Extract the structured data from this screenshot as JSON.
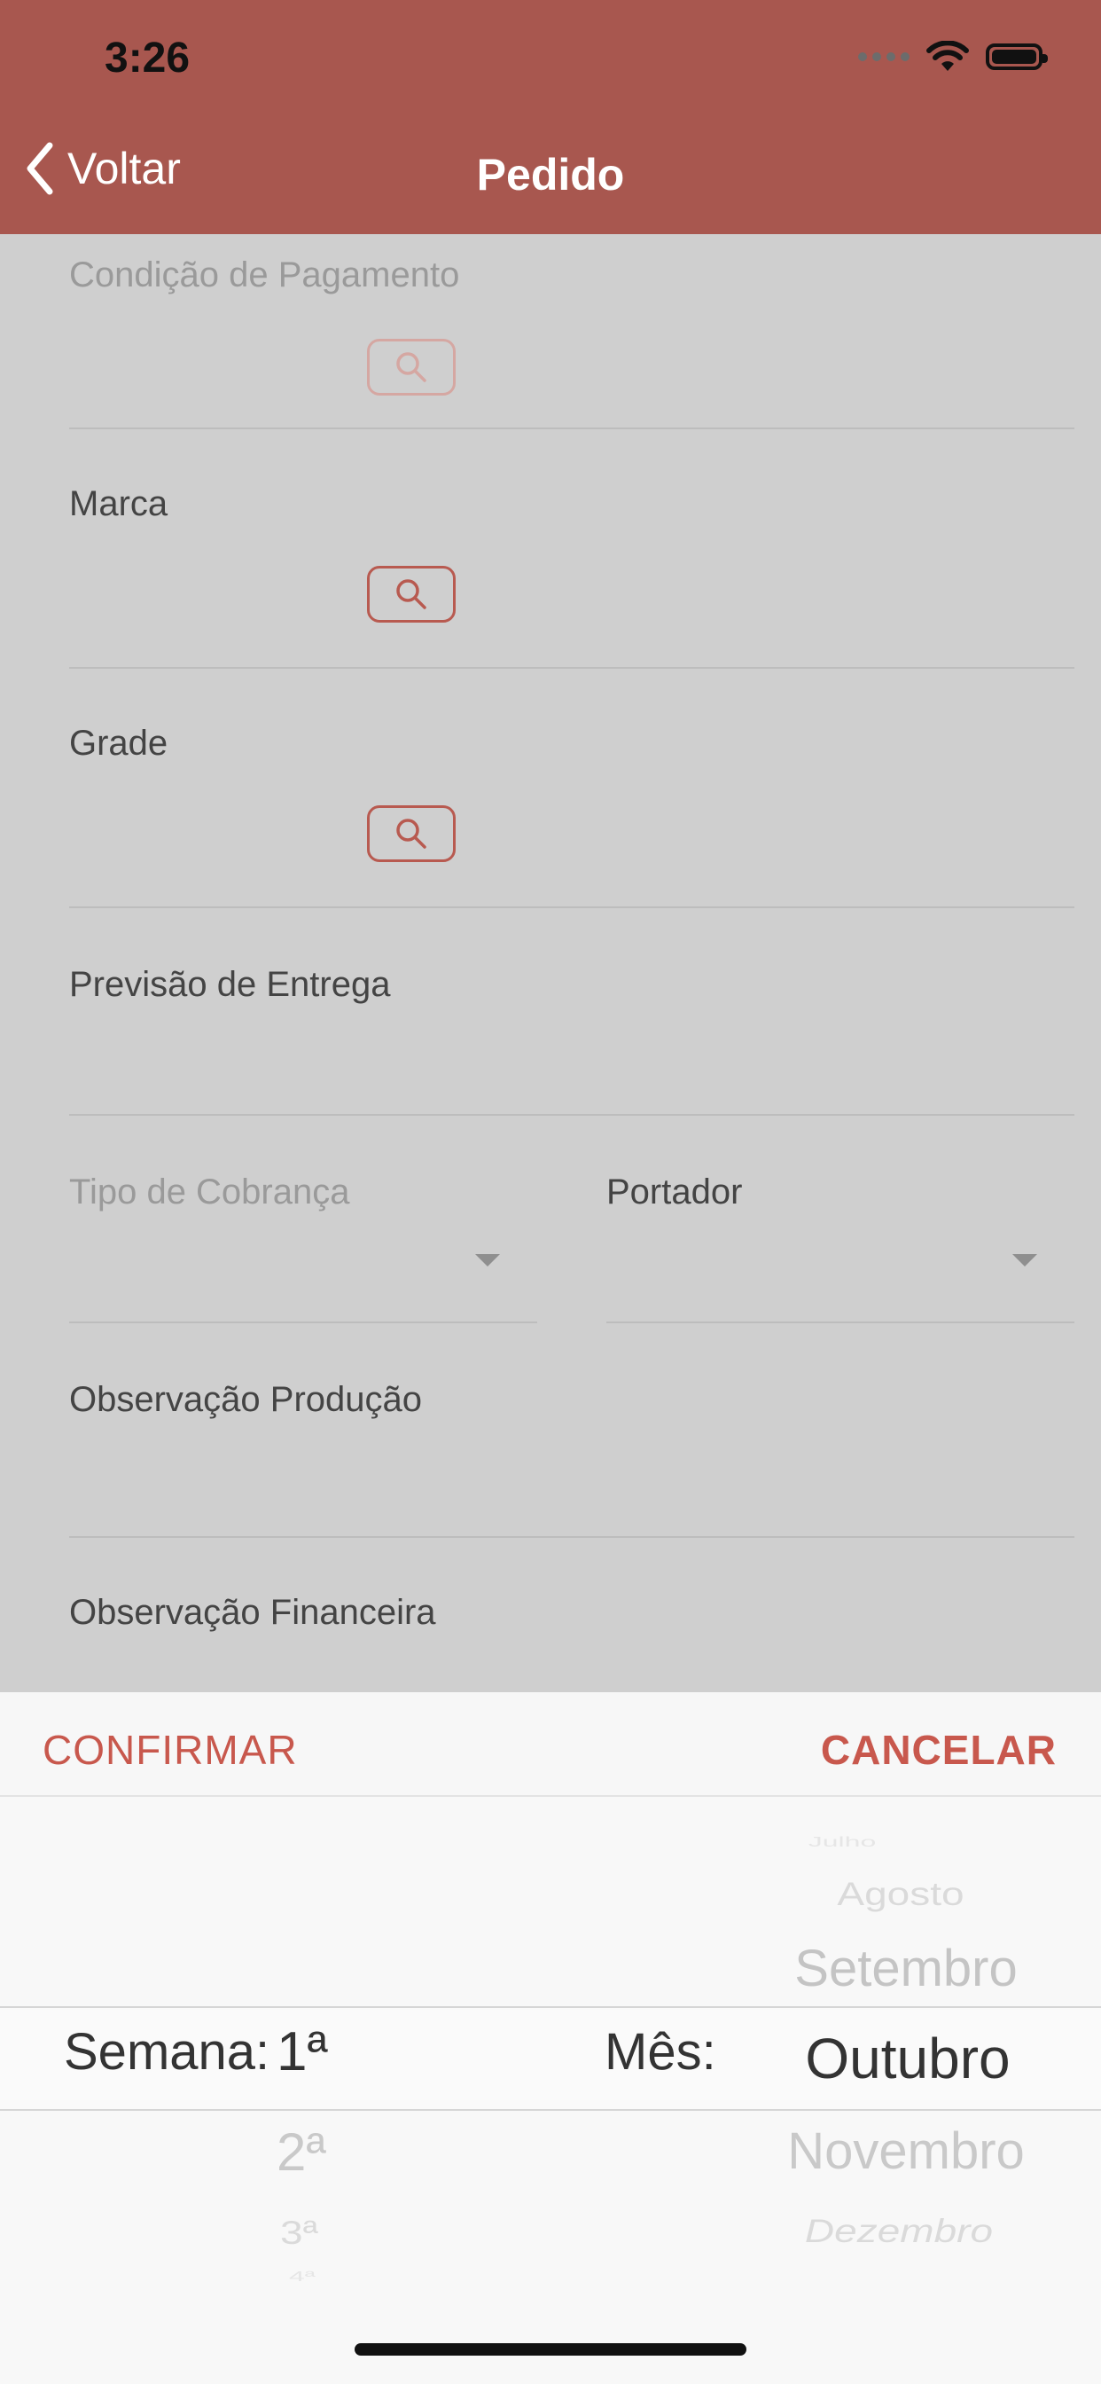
{
  "status_bar": {
    "time": "3:26"
  },
  "nav": {
    "back_label": "Voltar",
    "title": "Pedido"
  },
  "form": {
    "condicao_pagamento_label": "Condição de Pagamento",
    "marca_label": "Marca",
    "grade_label": "Grade",
    "previsao_entrega_label": "Previsão de Entrega",
    "tipo_cobranca_label": "Tipo de Cobrança",
    "portador_label": "Portador",
    "observacao_producao_label": "Observação Produção",
    "observacao_financeira_label": "Observação Financeira"
  },
  "picker": {
    "confirm_label": "CONFIRMAR",
    "cancel_label": "CANCELAR",
    "week_label": "Semana:",
    "month_label": "Mês:",
    "weeks": [
      "1ª",
      "2ª",
      "3ª",
      "4ª"
    ],
    "selected_week": "1ª",
    "months_above": [
      "Julho",
      "Agosto",
      "Setembro"
    ],
    "selected_month": "Outubro",
    "months_below": [
      "Novembro",
      "Dezembro"
    ]
  },
  "colors": {
    "header": "#a8574f",
    "accent": "#c8584d",
    "dim_background": "#cfcfcf"
  }
}
